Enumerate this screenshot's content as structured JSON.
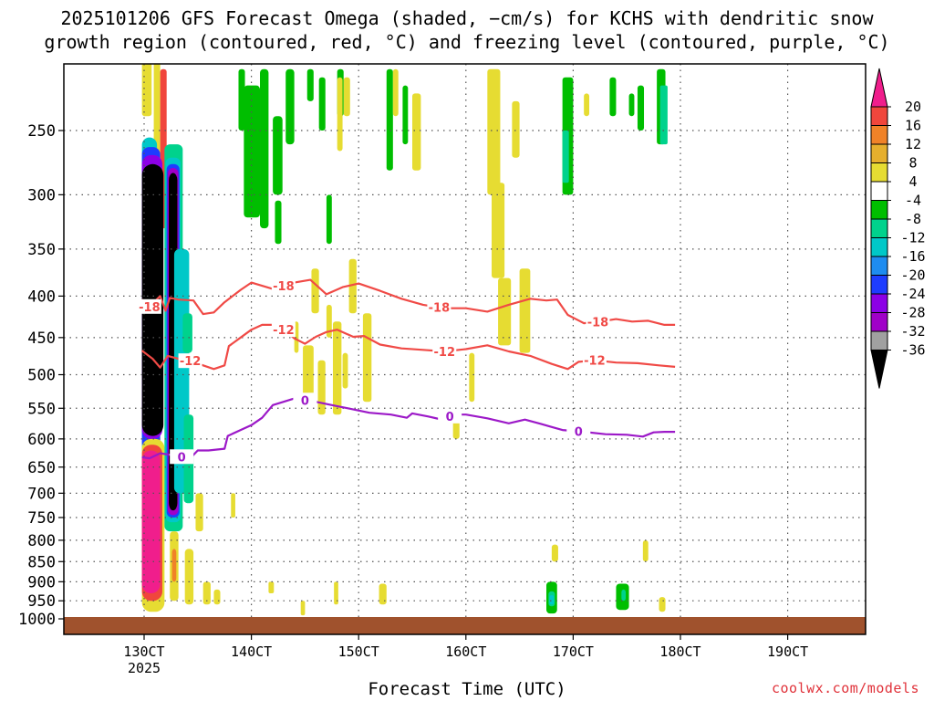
{
  "title_line1": "2025101206 GFS Forecast Omega (shaded, −cm/s) for KCHS with dendritic snow",
  "title_line2": "growth region (contoured, red, °C) and freezing level (contoured, purple, °C)",
  "x_axis_title": "Forecast Time (UTC)",
  "credit": "coolwx.com/models",
  "year_label": "2025",
  "colors": {
    "red_contour": "#f04a46",
    "purple_contour": "#9c19c8",
    "ground": "#a0522d"
  },
  "chart_data": {
    "type": "heatmap",
    "title": "2025101206 GFS Forecast Omega (shaded, −cm/s) for KCHS with dendritic snow growth region (contoured, red, °C) and freezing level (contoured, purple, °C)",
    "xlabel": "Forecast Time (UTC)",
    "ylabel": "",
    "x_ticks": [
      "130CT",
      "140CT",
      "150CT",
      "160CT",
      "170CT",
      "180CT",
      "190CT"
    ],
    "y_ticks": [
      250,
      300,
      350,
      400,
      450,
      500,
      550,
      600,
      650,
      700,
      750,
      800,
      850,
      900,
      950,
      1000
    ],
    "y_axis": "pressure (hPa), inverted",
    "grid": true,
    "colorbar": {
      "ticks": [
        20,
        16,
        12,
        8,
        4,
        -4,
        -8,
        -12,
        -16,
        -20,
        -24,
        -28,
        -32,
        -36
      ],
      "bins": [
        {
          "min": 20,
          "max": null,
          "color": "#f01e8c"
        },
        {
          "min": 16,
          "max": 20,
          "color": "#f0463c"
        },
        {
          "min": 12,
          "max": 16,
          "color": "#f08228"
        },
        {
          "min": 8,
          "max": 12,
          "color": "#e6af2d"
        },
        {
          "min": 4,
          "max": 8,
          "color": "#e6dc32"
        },
        {
          "min": -4,
          "max": 4,
          "color": "#ffffff"
        },
        {
          "min": -8,
          "max": -4,
          "color": "#00be00"
        },
        {
          "min": -12,
          "max": -8,
          "color": "#00d28c"
        },
        {
          "min": -16,
          "max": -12,
          "color": "#00c8c8"
        },
        {
          "min": -20,
          "max": -16,
          "color": "#1e8cf0"
        },
        {
          "min": -24,
          "max": -20,
          "color": "#1e3cff"
        },
        {
          "min": -28,
          "max": -24,
          "color": "#8c00e6"
        },
        {
          "min": -32,
          "max": -28,
          "color": "#a000c8"
        },
        {
          "min": -36,
          "max": -32,
          "color": "#a0a0a0"
        },
        {
          "min": null,
          "max": -36,
          "color": "#000000"
        }
      ]
    },
    "contours": [
      {
        "level": "-18",
        "color": "#f04a46",
        "points": [
          [
            12.8,
            404
          ],
          [
            13.5,
            412
          ],
          [
            14.5,
            400
          ],
          [
            15.0,
            417
          ],
          [
            15.4,
            402
          ],
          [
            16.2,
            404
          ],
          [
            17.6,
            405
          ],
          [
            18.5,
            421
          ],
          [
            19.5,
            419
          ],
          [
            20.5,
            407
          ],
          [
            22.0,
            393
          ],
          [
            23.0,
            385
          ],
          [
            25.0,
            392
          ],
          [
            27.0,
            385
          ],
          [
            28.5,
            382
          ],
          [
            30.0,
            398
          ],
          [
            31.5,
            390
          ],
          [
            33.0,
            386
          ],
          [
            35.0,
            394
          ],
          [
            37.0,
            403
          ],
          [
            39.0,
            410
          ],
          [
            41.0,
            414
          ],
          [
            43.0,
            414
          ],
          [
            45.0,
            418
          ],
          [
            47.0,
            410
          ],
          [
            49.0,
            403
          ],
          [
            50.5,
            405
          ],
          [
            51.5,
            404
          ],
          [
            52.5,
            422
          ],
          [
            54.0,
            432
          ],
          [
            55.5,
            430
          ],
          [
            57.0,
            427
          ],
          [
            58.5,
            430
          ],
          [
            60.0,
            429
          ],
          [
            61.5,
            434
          ],
          [
            62.5,
            434
          ]
        ],
        "labels": [
          [
            13.5,
            "-18"
          ],
          [
            26.0,
            "-18"
          ],
          [
            40.5,
            "-18"
          ],
          [
            55.3,
            "-18"
          ]
        ]
      },
      {
        "level": "-12",
        "color": "#f04a46",
        "points": [
          [
            12.8,
            467
          ],
          [
            13.8,
            478
          ],
          [
            14.5,
            490
          ],
          [
            15.2,
            474
          ],
          [
            16.2,
            478
          ],
          [
            17.2,
            480
          ],
          [
            18.5,
            487
          ],
          [
            19.5,
            492
          ],
          [
            20.5,
            487
          ],
          [
            20.9,
            461
          ],
          [
            22.0,
            450
          ],
          [
            23.0,
            440
          ],
          [
            24.0,
            434
          ],
          [
            25.0,
            434
          ],
          [
            26.0,
            440
          ],
          [
            27.0,
            451
          ],
          [
            28.0,
            458
          ],
          [
            29.0,
            449
          ],
          [
            30.0,
            443
          ],
          [
            31.0,
            440
          ],
          [
            32.5,
            449
          ],
          [
            33.5,
            448
          ],
          [
            35.0,
            459
          ],
          [
            37.0,
            464
          ],
          [
            39.0,
            466
          ],
          [
            41.0,
            468
          ],
          [
            43.0,
            465
          ],
          [
            45.0,
            460
          ],
          [
            47.0,
            468
          ],
          [
            49.0,
            474
          ],
          [
            51.0,
            485
          ],
          [
            52.5,
            492
          ],
          [
            53.5,
            482
          ],
          [
            55.0,
            480
          ],
          [
            57.0,
            483
          ],
          [
            59.0,
            484
          ],
          [
            61.0,
            487
          ],
          [
            62.5,
            489
          ]
        ],
        "labels": [
          [
            17.3,
            "-12"
          ],
          [
            26.0,
            "-12"
          ],
          [
            41.0,
            "-12"
          ],
          [
            55.0,
            "-12"
          ]
        ]
      },
      {
        "level": "0",
        "color": "#9c19c8",
        "points": [
          [
            12.8,
            632
          ],
          [
            13.5,
            634
          ],
          [
            14.5,
            625
          ],
          [
            15.5,
            628
          ],
          [
            16.5,
            631
          ],
          [
            17.0,
            640
          ],
          [
            18.0,
            620
          ],
          [
            19.0,
            620
          ],
          [
            20.5,
            617
          ],
          [
            20.8,
            595
          ],
          [
            22.0,
            585
          ],
          [
            23.0,
            577
          ],
          [
            24.0,
            565
          ],
          [
            25.0,
            545
          ],
          [
            26.0,
            540
          ],
          [
            27.0,
            535
          ],
          [
            27.5,
            536
          ],
          [
            29.0,
            540
          ],
          [
            30.5,
            545
          ],
          [
            32.0,
            550
          ],
          [
            34.0,
            557
          ],
          [
            36.0,
            560
          ],
          [
            37.5,
            565
          ],
          [
            38.0,
            558
          ],
          [
            39.5,
            563
          ],
          [
            40.5,
            567
          ],
          [
            42.0,
            560
          ],
          [
            43.0,
            560
          ],
          [
            45.0,
            566
          ],
          [
            47.0,
            574
          ],
          [
            48.5,
            568
          ],
          [
            50.0,
            575
          ],
          [
            51.0,
            580
          ],
          [
            52.0,
            585
          ],
          [
            54.0,
            588
          ],
          [
            56.0,
            592
          ],
          [
            58.0,
            593
          ],
          [
            59.5,
            596
          ],
          [
            60.5,
            589
          ],
          [
            61.5,
            588
          ],
          [
            62.5,
            588
          ]
        ],
        "labels": [
          [
            16.5,
            "0"
          ],
          [
            28.0,
            "0"
          ],
          [
            41.5,
            "0"
          ],
          [
            53.5,
            "0"
          ]
        ]
      }
    ],
    "fields": [
      {
        "label": "black core",
        "x": [
          12.8,
          14.8
        ],
        "p": [
          270,
          600
        ],
        "bin": "< -36"
      },
      {
        "label": "black core 2",
        "x": [
          15.4,
          16.2
        ],
        "p": [
          280,
          730
        ],
        "bin": "< -36"
      },
      {
        "label": "magenta low",
        "x": [
          12.8,
          14.5
        ],
        "p": [
          620,
          940
        ],
        "bin": "> 20"
      },
      {
        "label": "green columns",
        "x": [
          22.0,
          27.0
        ],
        "p": [
          210,
          420
        ],
        "bin": "-8 to -4"
      },
      {
        "label": "yellow column",
        "x": [
          45.0,
          47.0
        ],
        "p": [
          210,
          450
        ],
        "bin": "4 to 8"
      },
      {
        "label": "green block",
        "x": [
          52.0,
          53.0
        ],
        "p": [
          215,
          300
        ],
        "bin": "-8 to -4"
      }
    ]
  }
}
